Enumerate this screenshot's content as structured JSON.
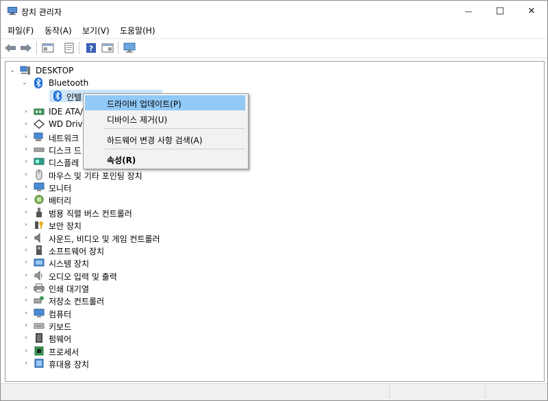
{
  "window": {
    "title": "장치 관리자",
    "min_glyph": "—",
    "max_glyph": "☐",
    "close_glyph": "✕"
  },
  "menu": [
    {
      "label": "파일(F)"
    },
    {
      "label": "동작(A)"
    },
    {
      "label": "보기(V)"
    },
    {
      "label": "도움말(H)"
    }
  ],
  "toolbar": [
    "back-arrow-icon",
    "forward-arrow-icon",
    "show-hide-tree-icon",
    "properties-icon",
    "help-icon",
    "driver-panel-icon",
    "monitor-scan-icon"
  ],
  "tree": {
    "root": "DESKTOP",
    "bluetooth": "Bluetooth",
    "bluetooth_child": "인텔",
    "categories": [
      {
        "label": "IDE ATA/",
        "icon": "ide-controller-icon"
      },
      {
        "label": "WD Drive",
        "icon": "wd-drive-icon"
      },
      {
        "label": "네트워크",
        "icon": "network-adapter-icon"
      },
      {
        "label": "디스크 드",
        "icon": "disk-drive-icon"
      },
      {
        "label": "디스플레",
        "icon": "display-adapter-icon"
      },
      {
        "label": "마우스 및 기타 포인팅 장치",
        "icon": "mouse-icon"
      },
      {
        "label": "모니터",
        "icon": "monitor-icon"
      },
      {
        "label": "배터리",
        "icon": "battery-icon"
      },
      {
        "label": "범용 직렬 버스 컨트롤러",
        "icon": "usb-icon"
      },
      {
        "label": "보안 장치",
        "icon": "security-key-icon"
      },
      {
        "label": "사운드, 비디오 및 게임 컨트롤러",
        "icon": "speaker-icon"
      },
      {
        "label": "소프트웨어 장치",
        "icon": "software-device-icon"
      },
      {
        "label": "시스템 장치",
        "icon": "system-device-icon"
      },
      {
        "label": "오디오 입력 및 출력",
        "icon": "audio-io-icon"
      },
      {
        "label": "인쇄 대기열",
        "icon": "printer-icon"
      },
      {
        "label": "저장소 컨트롤러",
        "icon": "storage-controller-icon"
      },
      {
        "label": "컴퓨터",
        "icon": "computer-icon"
      },
      {
        "label": "키보드",
        "icon": "keyboard-icon"
      },
      {
        "label": "펌웨어",
        "icon": "firmware-icon"
      },
      {
        "label": "프로세서",
        "icon": "processor-icon"
      },
      {
        "label": "휴대용 장치",
        "icon": "portable-device-icon"
      }
    ]
  },
  "context_menu": {
    "items": [
      {
        "label": "드라이버 업데이트(P)"
      },
      {
        "label": "디바이스 제거(U)"
      },
      {
        "label": "하드웨어 변경 사항 검색(A)"
      },
      {
        "label": "속성(R)"
      }
    ]
  },
  "colors": {
    "selection": "#cce4f7",
    "menu_highlight": "#91c9f7",
    "bluetooth_blue": "#1e6fd9"
  }
}
